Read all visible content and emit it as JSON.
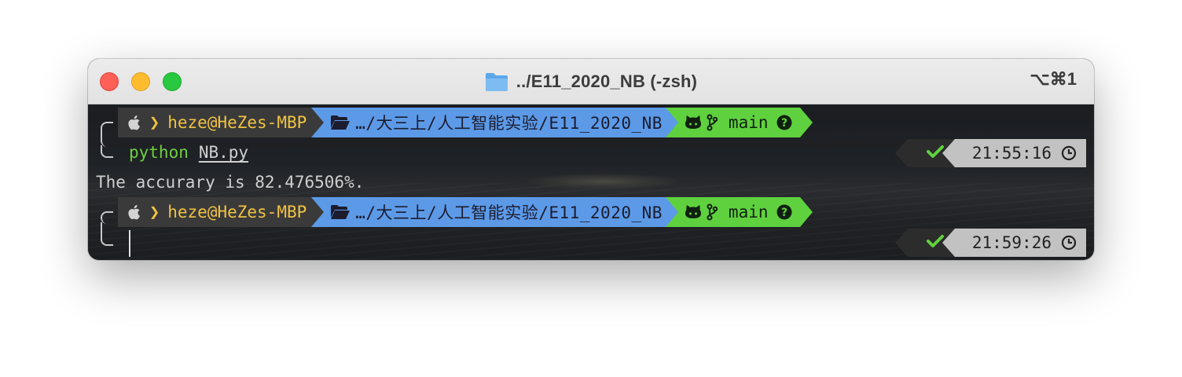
{
  "window": {
    "title": "../E11_2020_NB (-zsh)",
    "shortcut": "⌥⌘1"
  },
  "prompts": [
    {
      "user": "heze@HeZes-MBP",
      "path": "…/大三上/人工智能实验/E11_2020_NB",
      "branch": "main"
    },
    {
      "user": "heze@HeZes-MBP",
      "path": "…/大三上/人工智能实验/E11_2020_NB",
      "branch": "main"
    }
  ],
  "command": {
    "name": "python",
    "arg": "NB.py"
  },
  "output": "The accurary is 82.476506%.",
  "times": [
    "21:55:16",
    "21:59:26"
  ],
  "colors": {
    "os_segment": "#3a3a3a",
    "dir_segment": "#5c9ae8",
    "git_segment": "#5fd13f",
    "status_ok": "#5fd13f",
    "time_segment": "#c2c2c2"
  }
}
